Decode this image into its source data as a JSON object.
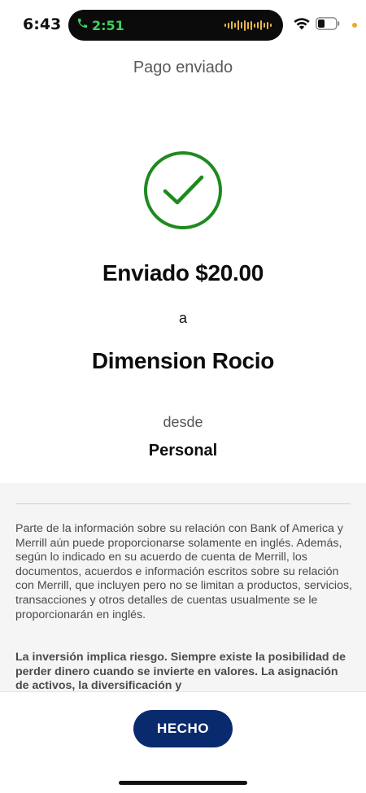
{
  "status_bar": {
    "time": "6:43",
    "call_time": "2:51",
    "icons": [
      "phone-icon",
      "audio-wave-icon",
      "wifi-icon",
      "battery-icon"
    ],
    "call_color": "#3bd35a",
    "indicator_color": "#f5a623"
  },
  "header": {
    "title": "Pago enviado"
  },
  "confirmation": {
    "icon": "check-circle-icon",
    "icon_color": "#1e8a1e",
    "amount_line": "Enviado $20.00",
    "to_label": "a",
    "recipient": "Dimension Rocio",
    "from_label": "desde",
    "account": "Personal"
  },
  "disclaimer": {
    "text": "Parte de la información sobre su relación con Bank of America y Merrill aún puede proporcionarse solamente en inglés. Además, según lo indicado en su acuerdo de cuenta de Merrill, los documentos, acuerdos e información escritos sobre su relación con Merrill, que incluyen pero no se limitan a productos, servicios, transacciones y otros detalles de cuentas usualmente se le proporcionarán en inglés.",
    "bold_text": "La inversión implica riesgo. Siempre existe la posibilidad de perder dinero cuando se invierte en valores. La asignación de activos, la diversificación y"
  },
  "footer": {
    "done_label": "HECHO",
    "button_color": "#0a2a6e"
  }
}
